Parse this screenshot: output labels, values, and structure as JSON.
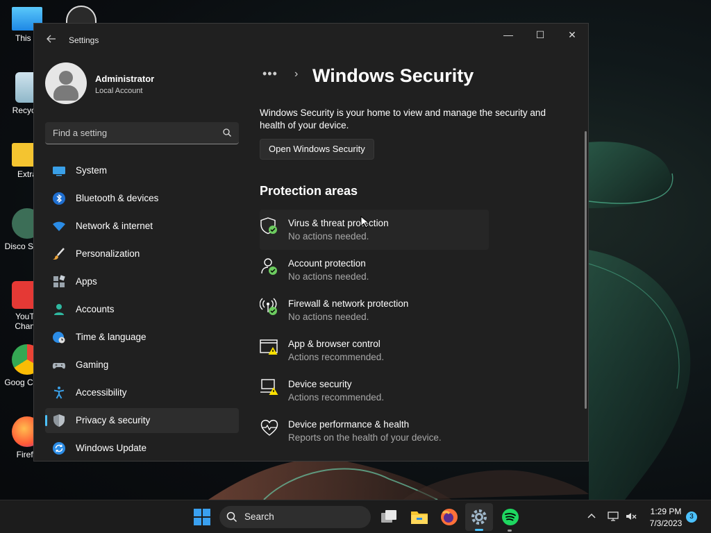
{
  "window": {
    "app_title": "Settings",
    "controls": {
      "minimize": "—",
      "maximize": "☐",
      "close": "✕"
    }
  },
  "profile": {
    "name": "Administrator",
    "account_type": "Local Account"
  },
  "search": {
    "placeholder": "Find a setting"
  },
  "sidebar": {
    "items": [
      {
        "label": "System",
        "icon": "monitor-icon",
        "active": false
      },
      {
        "label": "Bluetooth & devices",
        "icon": "bluetooth-icon",
        "active": false
      },
      {
        "label": "Network & internet",
        "icon": "wifi-icon",
        "active": false
      },
      {
        "label": "Personalization",
        "icon": "brush-icon",
        "active": false
      },
      {
        "label": "Apps",
        "icon": "apps-icon",
        "active": false
      },
      {
        "label": "Accounts",
        "icon": "person-icon",
        "active": false
      },
      {
        "label": "Time & language",
        "icon": "globe-clock-icon",
        "active": false
      },
      {
        "label": "Gaming",
        "icon": "gamepad-icon",
        "active": false
      },
      {
        "label": "Accessibility",
        "icon": "accessibility-icon",
        "active": false
      },
      {
        "label": "Privacy & security",
        "icon": "shield-icon",
        "active": true
      },
      {
        "label": "Windows Update",
        "icon": "update-icon",
        "active": false
      }
    ]
  },
  "content": {
    "breadcrumb_overflow": "•••",
    "breadcrumb_separator": "›",
    "title": "Windows Security",
    "description": "Windows Security is your home to view and manage the security and health of your device.",
    "open_button": "Open Windows Security",
    "section_title": "Protection areas",
    "areas": [
      {
        "title": "Virus & threat protection",
        "status": "No actions needed.",
        "icon": "virus-shield-icon",
        "state": "ok"
      },
      {
        "title": "Account protection",
        "status": "No actions needed.",
        "icon": "account-protection-icon",
        "state": "ok"
      },
      {
        "title": "Firewall & network protection",
        "status": "No actions needed.",
        "icon": "firewall-icon",
        "state": "ok"
      },
      {
        "title": "App & browser control",
        "status": "Actions recommended.",
        "icon": "app-browser-icon",
        "state": "warning"
      },
      {
        "title": "Device security",
        "status": "Actions recommended.",
        "icon": "device-security-icon",
        "state": "warning"
      },
      {
        "title": "Device performance & health",
        "status": "Reports on the health of your device.",
        "icon": "heart-icon",
        "state": "none"
      }
    ]
  },
  "desktop": {
    "icons": [
      {
        "label": "This P"
      },
      {
        "label": "Recycle"
      },
      {
        "label": "Extra"
      },
      {
        "label": "Disco Serve"
      },
      {
        "label": "YouTu Chann"
      },
      {
        "label": "Goog Chron"
      },
      {
        "label": "Firefo"
      }
    ]
  },
  "taskbar": {
    "search_label": "Search",
    "time": "1:29 PM",
    "date": "7/3/2023",
    "notification_count": "3"
  },
  "colors": {
    "accent": "#4cc2ff",
    "ok": "#6ccb5f",
    "warning": "#fce100"
  }
}
